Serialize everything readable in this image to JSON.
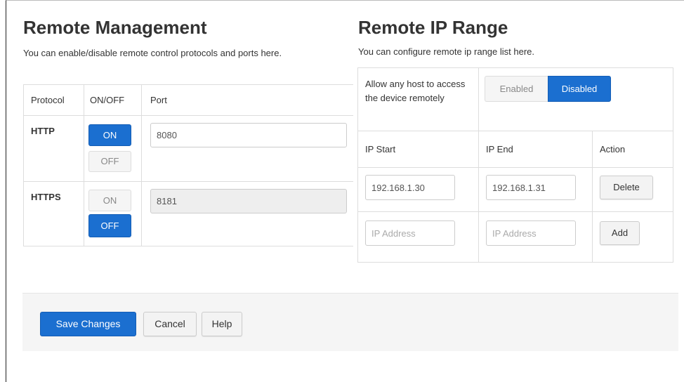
{
  "remote_management": {
    "title": "Remote Management",
    "description": "You can enable/disable remote control protocols and ports here.",
    "headers": {
      "protocol": "Protocol",
      "onoff": "ON/OFF",
      "port": "Port"
    },
    "rows": [
      {
        "protocol": "HTTP",
        "on_label": "ON",
        "off_label": "OFF",
        "state": "ON",
        "port": "8080",
        "port_disabled": false
      },
      {
        "protocol": "HTTPS",
        "on_label": "ON",
        "off_label": "OFF",
        "state": "OFF",
        "port": "8181",
        "port_disabled": true
      }
    ]
  },
  "remote_ip_range": {
    "title": "Remote IP Range",
    "description": "You can configure remote ip range list here.",
    "allow_any_label": "Allow any host to access the device remotely",
    "toggle": {
      "enabled_label": "Enabled",
      "disabled_label": "Disabled",
      "selected": "Disabled"
    },
    "headers": {
      "ip_start": "IP Start",
      "ip_end": "IP End",
      "action": "Action"
    },
    "rows": [
      {
        "ip_start": "192.168.1.30",
        "ip_end": "192.168.1.31",
        "action": "Delete"
      }
    ],
    "new_row": {
      "ip_start_placeholder": "IP Address",
      "ip_end_placeholder": "IP Address",
      "action": "Add"
    }
  },
  "footer": {
    "save_label": "Save Changes",
    "cancel_label": "Cancel",
    "help_label": "Help"
  },
  "colors": {
    "primary": "#1b6fd0",
    "border": "#dddddd",
    "footer_bg": "#f5f5f5"
  }
}
